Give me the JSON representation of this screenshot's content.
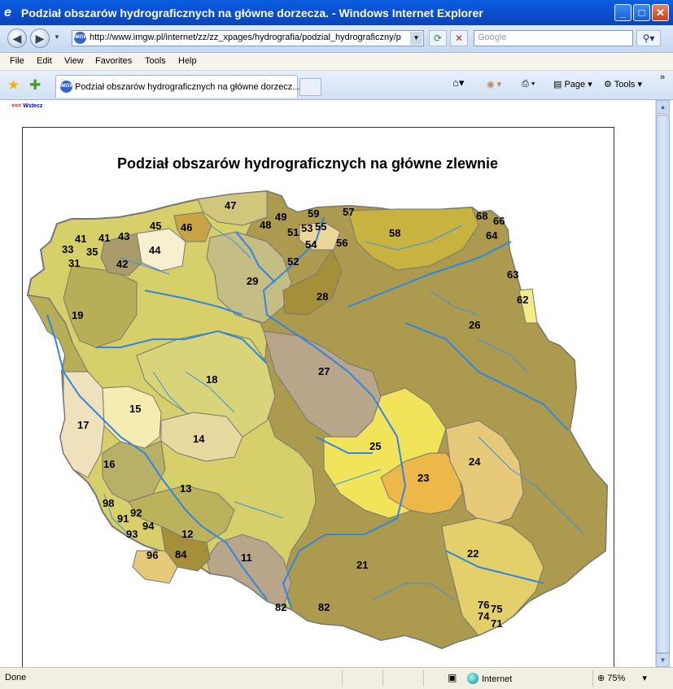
{
  "window": {
    "title": "Podział obszarów hydrograficznych na główne dorzecza. - Windows Internet Explorer",
    "minimize": "_",
    "maximize": "□",
    "close": "✕"
  },
  "address": {
    "url": "http://www.imgw.pl/internet/zz/zz_xpages/hydrografia/podzial_hydrograficzny/p",
    "search_placeholder": "Google",
    "site_icon_text": "IMGW"
  },
  "menu": {
    "items": [
      "File",
      "Edit",
      "View",
      "Favorites",
      "Tools",
      "Help"
    ]
  },
  "tabs": {
    "active_label": "Podział obszarów hydrograficznych na główne dorzecz...",
    "commands": {
      "page": "Page",
      "tools": "Tools"
    }
  },
  "page": {
    "back_arrows": "<<<",
    "back_text": "Wstecz",
    "map_title": "Podział  obszarów hydrograficznych na główne zlewnie",
    "region_labels": [
      "47",
      "49",
      "59",
      "57",
      "68",
      "66",
      "64",
      "45",
      "46",
      "48",
      "51",
      "53",
      "55",
      "58",
      "41",
      "41",
      "43",
      "33",
      "35",
      "44",
      "54",
      "56",
      "31",
      "42",
      "52",
      "63",
      "29",
      "28",
      "62",
      "19",
      "26",
      "27",
      "18",
      "15",
      "17",
      "14",
      "25",
      "24",
      "16",
      "23",
      "13",
      "98",
      "92",
      "91",
      "94",
      "93",
      "12",
      "22",
      "96",
      "84",
      "11",
      "21",
      "76",
      "75",
      "82",
      "82",
      "74",
      "71"
    ],
    "colors": {
      "odra_green": "#d6cf6a",
      "wisla_olive": "#ac9a4e",
      "yellow": "#f1e35a",
      "orange": "#ecb84a",
      "sand": "#e7c97a",
      "gray": "#b8a58a",
      "khaki": "#b7ae57",
      "river": "#2f86e3",
      "border": "#777777"
    }
  },
  "status": {
    "text": "Done",
    "zone": "Internet",
    "zoom": "75%"
  },
  "icons": {
    "back": "left-arrow-icon",
    "forward": "right-arrow-icon",
    "refresh": "refresh-icon",
    "stop": "stop-icon",
    "search": "search-icon",
    "home": "home-icon",
    "feeds": "rss-icon",
    "print": "printer-icon",
    "favorites": "star-icon",
    "add_favorite": "add-favorite-icon"
  }
}
